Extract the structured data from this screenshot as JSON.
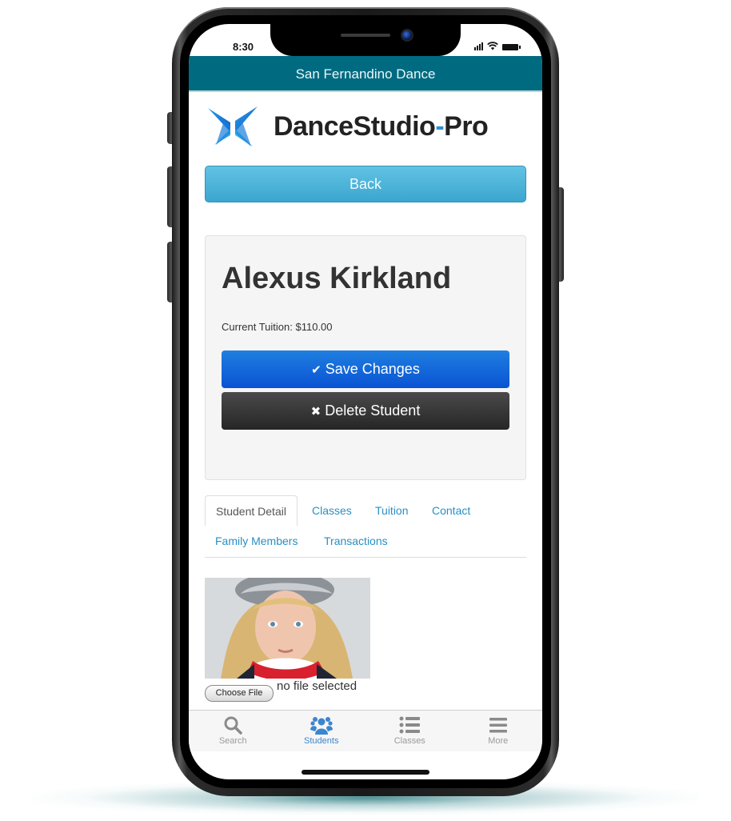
{
  "device": {
    "status_time": "8:30"
  },
  "header": {
    "title": "San Fernandino Dance"
  },
  "brand": {
    "name_main": "DanceStudio",
    "name_dash": "-",
    "name_suffix": "Pro",
    "accent_color": "#2a8fd4"
  },
  "nav": {
    "back_label": "Back"
  },
  "student": {
    "name": "Alexus Kirkland",
    "tuition_label": "Current Tuition: $110.00",
    "save_glyph": "✔",
    "save_label": "Save Changes",
    "delete_glyph": "✖",
    "delete_label": "Delete Student"
  },
  "tabs": [
    {
      "label": "Student Detail",
      "active": true
    },
    {
      "label": "Classes",
      "active": false
    },
    {
      "label": "Tuition",
      "active": false
    },
    {
      "label": "Contact",
      "active": false
    },
    {
      "label": "Family Members",
      "active": false
    },
    {
      "label": "Transactions",
      "active": false
    }
  ],
  "photo": {
    "choose_file_label": "Choose File",
    "file_status": "no file selected"
  },
  "tab_bar": [
    {
      "label": "Search",
      "icon": "search-icon",
      "active": false
    },
    {
      "label": "Students",
      "icon": "students-icon",
      "active": true
    },
    {
      "label": "Classes",
      "icon": "list-icon",
      "active": false
    },
    {
      "label": "More",
      "icon": "menu-icon",
      "active": false
    }
  ],
  "colors": {
    "header_bg": "#006b80",
    "primary_button": "#0a53d4",
    "danger_button": "#262626",
    "back_button": "#3ba6cf",
    "link": "#2a8fc4",
    "tab_active": "#3a86cf"
  }
}
